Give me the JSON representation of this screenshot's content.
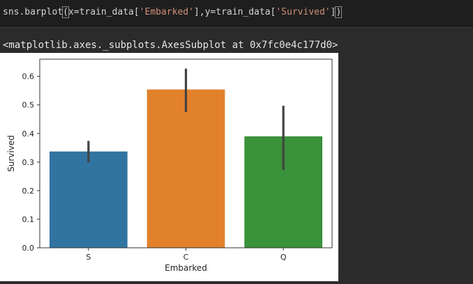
{
  "code_cell": {
    "fn": "sns.barplot",
    "open": "(",
    "arg1_prefix": "x=train_data[",
    "arg1_str": "'Embarked'",
    "arg1_suffix": "],y=train_data[",
    "arg2_str": "'Survived'",
    "arg2_suffix": "]",
    "close": ")"
  },
  "output": {
    "repr": "<matplotlib.axes._subplots.AxesSubplot at 0x7fc0e4c177d0>"
  },
  "chart_data": {
    "type": "bar",
    "title": "",
    "xlabel": "Embarked",
    "ylabel": "Survived",
    "categories": [
      "S",
      "C",
      "Q"
    ],
    "values": [
      0.337,
      0.554,
      0.39
    ],
    "ci_low": [
      0.299,
      0.475,
      0.272
    ],
    "ci_high": [
      0.374,
      0.627,
      0.497
    ],
    "colors": [
      "#3274a1",
      "#e1812c",
      "#3a923a"
    ],
    "ylim": [
      0,
      0.66
    ],
    "yticks": [
      0.0,
      0.1,
      0.2,
      0.3,
      0.4,
      0.5,
      0.6
    ],
    "ytick_labels": [
      "0.0",
      "0.1",
      "0.2",
      "0.3",
      "0.4",
      "0.5",
      "0.6"
    ],
    "grid": false,
    "errorbar_color": "#424242"
  }
}
